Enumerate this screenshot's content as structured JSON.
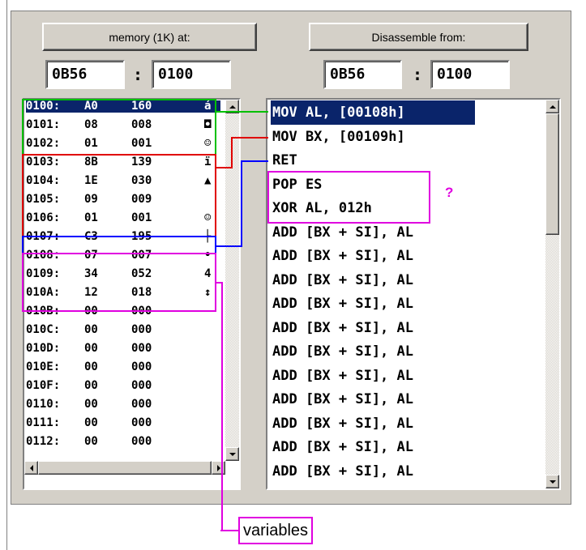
{
  "memory": {
    "button_label": "memory (1K) at:",
    "segment": "0B56",
    "separator": ":",
    "offset": "0100",
    "rows": [
      {
        "addr": "0100:",
        "hex": "A0",
        "dec": "160",
        "ch": "á"
      },
      {
        "addr": "0101:",
        "hex": "08",
        "dec": "008",
        "ch": "◘"
      },
      {
        "addr": "0102:",
        "hex": "01",
        "dec": "001",
        "ch": "☺"
      },
      {
        "addr": "0103:",
        "hex": "8B",
        "dec": "139",
        "ch": "ï"
      },
      {
        "addr": "0104:",
        "hex": "1E",
        "dec": "030",
        "ch": "▲"
      },
      {
        "addr": "0105:",
        "hex": "09",
        "dec": "009",
        "ch": ""
      },
      {
        "addr": "0106:",
        "hex": "01",
        "dec": "001",
        "ch": "☺"
      },
      {
        "addr": "0107:",
        "hex": "C3",
        "dec": "195",
        "ch": "├"
      },
      {
        "addr": "0108:",
        "hex": "07",
        "dec": "007",
        "ch": "•"
      },
      {
        "addr": "0109:",
        "hex": "34",
        "dec": "052",
        "ch": "4"
      },
      {
        "addr": "010A:",
        "hex": "12",
        "dec": "018",
        "ch": "↕"
      },
      {
        "addr": "010B:",
        "hex": "00",
        "dec": "000",
        "ch": ""
      },
      {
        "addr": "010C:",
        "hex": "00",
        "dec": "000",
        "ch": ""
      },
      {
        "addr": "010D:",
        "hex": "00",
        "dec": "000",
        "ch": ""
      },
      {
        "addr": "010E:",
        "hex": "00",
        "dec": "000",
        "ch": ""
      },
      {
        "addr": "010F:",
        "hex": "00",
        "dec": "000",
        "ch": ""
      },
      {
        "addr": "0110:",
        "hex": "00",
        "dec": "000",
        "ch": ""
      },
      {
        "addr": "0111:",
        "hex": "00",
        "dec": "000",
        "ch": ""
      },
      {
        "addr": "0112:",
        "hex": "00",
        "dec": "000",
        "ch": ""
      }
    ],
    "selected_index": 0
  },
  "disassemble": {
    "button_label": "Disassemble from:",
    "segment": "0B56",
    "separator": ":",
    "offset": "0100",
    "rows": [
      "MOV AL, [00108h]",
      "MOV BX, [00109h]",
      "RET",
      "POP ES",
      "XOR AL, 012h",
      "ADD [BX + SI], AL",
      "ADD [BX + SI], AL",
      "ADD [BX + SI], AL",
      "ADD [BX + SI], AL",
      "ADD [BX + SI], AL",
      "ADD [BX + SI], AL",
      "ADD [BX + SI], AL",
      "ADD [BX + SI], AL",
      "ADD [BX + SI], AL",
      "ADD [BX + SI], AL",
      "ADD [BX + SI], AL"
    ],
    "selected_index": 0
  },
  "annotations": {
    "question_mark": "?",
    "variables_label": "variables",
    "colors": {
      "green": "#00c000",
      "red": "#e00000",
      "blue": "#0000ff",
      "magenta": "#e000e0"
    }
  },
  "icons": [
    "scroll-up-arrow",
    "scroll-down-arrow",
    "scroll-left-arrow",
    "scroll-right-arrow"
  ]
}
